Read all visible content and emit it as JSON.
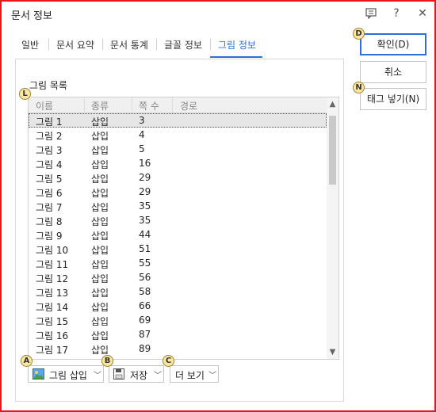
{
  "window": {
    "title": "문서 정보",
    "tabs": [
      {
        "label": "일반"
      },
      {
        "label": "문서 요약"
      },
      {
        "label": "문서 통계"
      },
      {
        "label": "글꼴 정보"
      },
      {
        "label": "그림 정보",
        "active": true
      }
    ]
  },
  "list": {
    "label": "그림 목록",
    "columns": [
      "이름",
      "종류",
      "쪽 수",
      "경로"
    ],
    "rows": [
      {
        "name": "그림 1",
        "type": "삽입",
        "page": "3",
        "selected": true
      },
      {
        "name": "그림 2",
        "type": "삽입",
        "page": "4"
      },
      {
        "name": "그림 3",
        "type": "삽입",
        "page": "5"
      },
      {
        "name": "그림 4",
        "type": "삽입",
        "page": "16"
      },
      {
        "name": "그림 5",
        "type": "삽입",
        "page": "29"
      },
      {
        "name": "그림 6",
        "type": "삽입",
        "page": "29"
      },
      {
        "name": "그림 7",
        "type": "삽입",
        "page": "35"
      },
      {
        "name": "그림 8",
        "type": "삽입",
        "page": "35"
      },
      {
        "name": "그림 9",
        "type": "삽입",
        "page": "44"
      },
      {
        "name": "그림 10",
        "type": "삽입",
        "page": "51"
      },
      {
        "name": "그림 11",
        "type": "삽입",
        "page": "55"
      },
      {
        "name": "그림 12",
        "type": "삽입",
        "page": "56"
      },
      {
        "name": "그림 13",
        "type": "삽입",
        "page": "58"
      },
      {
        "name": "그림 14",
        "type": "삽입",
        "page": "66"
      },
      {
        "name": "그림 15",
        "type": "삽입",
        "page": "69"
      },
      {
        "name": "그림 16",
        "type": "삽입",
        "page": "87"
      },
      {
        "name": "그림 17",
        "type": "삽입",
        "page": "89"
      }
    ]
  },
  "bottom_buttons": {
    "insert": "그림 삽입",
    "save": "저장",
    "more": "더 보기"
  },
  "side_buttons": {
    "ok": "확인(D)",
    "cancel": "취소",
    "insert_tag": "태그 넣기(N)"
  },
  "markers": {
    "A": "A",
    "B": "B",
    "C": "C",
    "D": "D",
    "L": "L",
    "N": "N"
  },
  "colors": {
    "accent": "#2d6fd6",
    "frame": "#e8161c",
    "marker_fill": "#fbe7a1"
  }
}
